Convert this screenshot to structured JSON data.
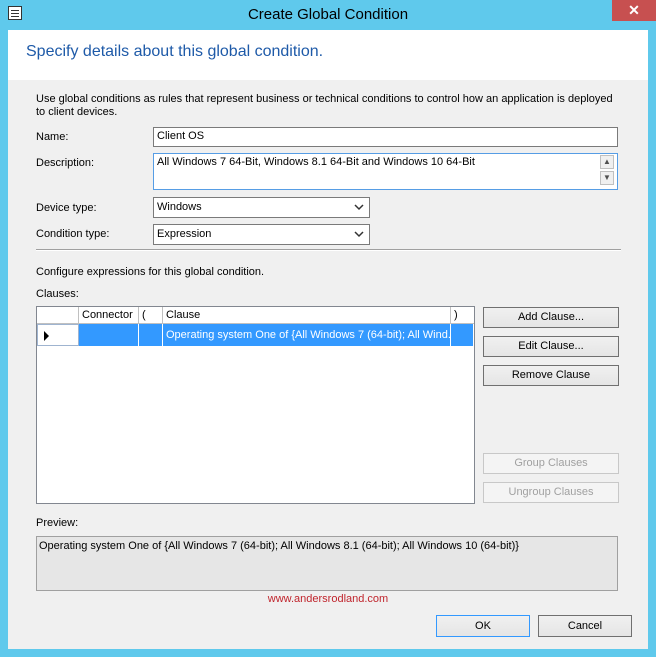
{
  "window": {
    "title": "Create Global Condition",
    "close_glyph": "✕"
  },
  "banner": {
    "heading": "Specify details about this global condition."
  },
  "intro": "Use global conditions as rules that represent business or technical conditions to control how an application is deployed to client devices.",
  "form": {
    "name_label": "Name:",
    "name_value": "Client OS",
    "description_label": "Description:",
    "description_value": "All Windows 7 64-Bit, Windows 8.1 64-Bit and Windows 10 64-Bit",
    "device_type_label": "Device type:",
    "device_type_value": "Windows",
    "condition_type_label": "Condition type:",
    "condition_type_value": "Expression"
  },
  "expressions": {
    "caption": "Configure expressions for this global condition.",
    "clauses_label": "Clauses:",
    "columns": [
      "Connector",
      "(",
      "Clause",
      ")"
    ],
    "rows": [
      {
        "connector": "",
        "open": "",
        "clause": "Operating system One of {All Windows 7 (64-bit); All Wind...",
        "close": ""
      }
    ]
  },
  "buttons": {
    "add_clause": "Add Clause...",
    "edit_clause": "Edit Clause...",
    "remove_clause": "Remove Clause",
    "group_clauses": "Group Clauses",
    "ungroup_clauses": "Ungroup Clauses",
    "ok": "OK",
    "cancel": "Cancel"
  },
  "preview": {
    "label": "Preview:",
    "text": "Operating system One of {All Windows 7 (64-bit); All Windows 8.1 (64-bit); All Windows 10 (64-bit)}"
  },
  "watermark": "www.andersrodland.com",
  "colors": {
    "frame": "#5fc9ec",
    "heading": "#1e5aa8",
    "selection": "#3399ff",
    "close": "#c75050",
    "watermark": "#c0252d"
  }
}
